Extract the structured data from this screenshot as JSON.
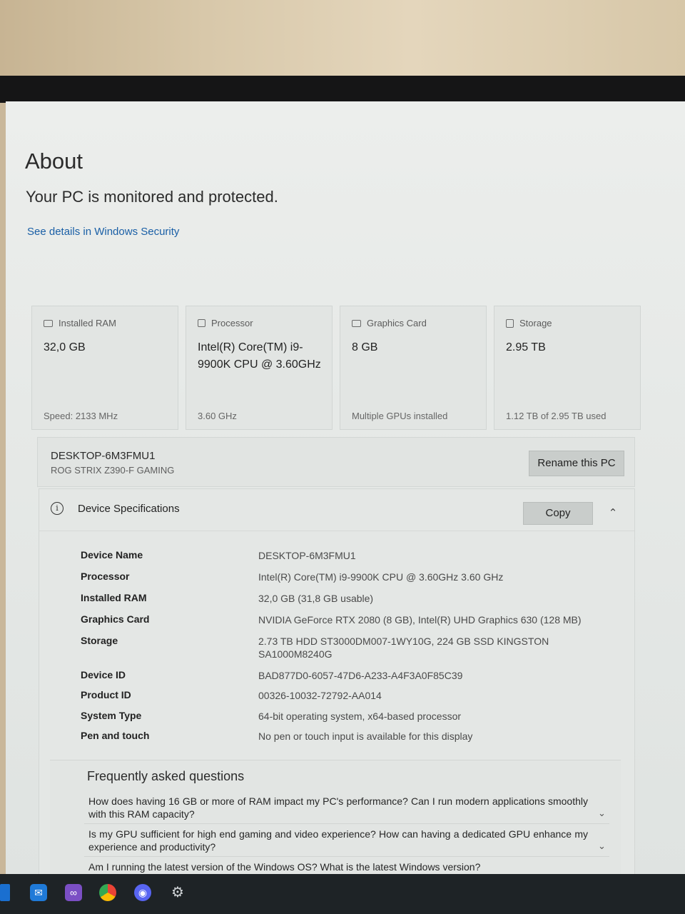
{
  "page": {
    "title": "About",
    "status": "Your PC is monitored and protected.",
    "security_link": "See details in Windows Security"
  },
  "cards": [
    {
      "label": "Installed RAM",
      "icon": "ram-icon",
      "value": "32,0 GB",
      "footer": "Speed: 2133 MHz"
    },
    {
      "label": "Processor",
      "icon": "processor-icon",
      "value": "Intel(R) Core(TM) i9-9900K CPU @ 3.60GHz",
      "footer": "3.60 GHz"
    },
    {
      "label": "Graphics Card",
      "icon": "graphics-card-icon",
      "value": "8 GB",
      "footer": "Multiple GPUs installed"
    },
    {
      "label": "Storage",
      "icon": "storage-icon",
      "value": "2.95 TB",
      "footer": "1.12 TB of 2.95 TB used"
    }
  ],
  "device": {
    "name": "DESKTOP-6M3FMU1",
    "model": "ROG STRIX Z390-F GAMING",
    "rename_label": "Rename this PC"
  },
  "specs": {
    "title": "Device Specifications",
    "copy_label": "Copy",
    "rows": [
      {
        "key": "Device Name",
        "value": "DESKTOP-6M3FMU1"
      },
      {
        "key": "Processor",
        "value": "Intel(R) Core(TM) i9-9900K CPU @ 3.60GHz   3.60 GHz"
      },
      {
        "key": "Installed RAM",
        "value": "32,0 GB (31,8 GB usable)"
      },
      {
        "key": "Graphics Card",
        "value": "NVIDIA GeForce RTX 2080 (8 GB), Intel(R) UHD Graphics 630 (128 MB)"
      },
      {
        "key": "Storage",
        "value": "2.73 TB HDD ST3000DM007-1WY10G, 224 GB SSD KINGSTON SA1000M8240G"
      },
      {
        "key": "Device ID",
        "value": "BAD877D0-6057-47D6-A233-A4F3A0F85C39"
      },
      {
        "key": "Product ID",
        "value": "00326-10032-72792-AA014"
      },
      {
        "key": "System Type",
        "value": "64-bit operating system, x64-based processor"
      },
      {
        "key": "Pen and touch",
        "value": "No pen or touch input is available for this display"
      }
    ]
  },
  "faq": {
    "title": "Frequently asked questions",
    "questions": [
      "How does having 16 GB or more of RAM impact my PC's performance? Can I run modern applications smoothly with this RAM capacity?",
      "Is my GPU sufficient for high end gaming and video experience? How can having a dedicated GPU enhance my experience and productivity?",
      "Am I running the latest version of the Windows OS? What is the latest Windows version?"
    ]
  },
  "taskbar": {
    "icons": [
      "store-icon",
      "mail-icon",
      "visual-studio-icon",
      "chrome-icon",
      "discord-icon",
      "settings-gear-icon"
    ]
  },
  "colors": {
    "accent_link": "#1a5fa6",
    "taskbar": "#1e2326"
  }
}
